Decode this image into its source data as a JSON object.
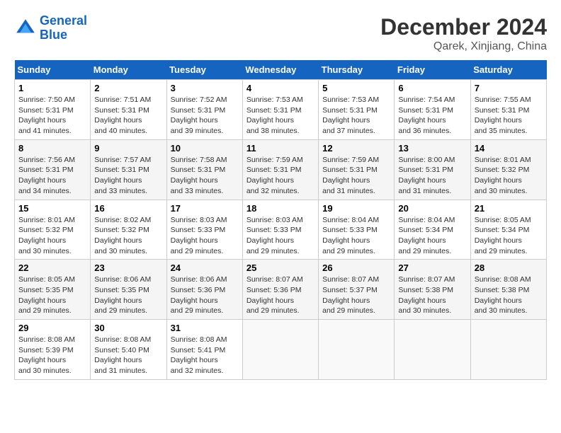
{
  "header": {
    "logo_line1": "General",
    "logo_line2": "Blue",
    "month_title": "December 2024",
    "location": "Qarek, Xinjiang, China"
  },
  "weekdays": [
    "Sunday",
    "Monday",
    "Tuesday",
    "Wednesday",
    "Thursday",
    "Friday",
    "Saturday"
  ],
  "weeks": [
    [
      {
        "day": "1",
        "sunrise": "7:50 AM",
        "sunset": "5:31 PM",
        "daylight": "9 hours and 41 minutes."
      },
      {
        "day": "2",
        "sunrise": "7:51 AM",
        "sunset": "5:31 PM",
        "daylight": "9 hours and 40 minutes."
      },
      {
        "day": "3",
        "sunrise": "7:52 AM",
        "sunset": "5:31 PM",
        "daylight": "9 hours and 39 minutes."
      },
      {
        "day": "4",
        "sunrise": "7:53 AM",
        "sunset": "5:31 PM",
        "daylight": "9 hours and 38 minutes."
      },
      {
        "day": "5",
        "sunrise": "7:53 AM",
        "sunset": "5:31 PM",
        "daylight": "9 hours and 37 minutes."
      },
      {
        "day": "6",
        "sunrise": "7:54 AM",
        "sunset": "5:31 PM",
        "daylight": "9 hours and 36 minutes."
      },
      {
        "day": "7",
        "sunrise": "7:55 AM",
        "sunset": "5:31 PM",
        "daylight": "9 hours and 35 minutes."
      }
    ],
    [
      {
        "day": "8",
        "sunrise": "7:56 AM",
        "sunset": "5:31 PM",
        "daylight": "9 hours and 34 minutes."
      },
      {
        "day": "9",
        "sunrise": "7:57 AM",
        "sunset": "5:31 PM",
        "daylight": "9 hours and 33 minutes."
      },
      {
        "day": "10",
        "sunrise": "7:58 AM",
        "sunset": "5:31 PM",
        "daylight": "9 hours and 33 minutes."
      },
      {
        "day": "11",
        "sunrise": "7:59 AM",
        "sunset": "5:31 PM",
        "daylight": "9 hours and 32 minutes."
      },
      {
        "day": "12",
        "sunrise": "7:59 AM",
        "sunset": "5:31 PM",
        "daylight": "9 hours and 31 minutes."
      },
      {
        "day": "13",
        "sunrise": "8:00 AM",
        "sunset": "5:31 PM",
        "daylight": "9 hours and 31 minutes."
      },
      {
        "day": "14",
        "sunrise": "8:01 AM",
        "sunset": "5:32 PM",
        "daylight": "9 hours and 30 minutes."
      }
    ],
    [
      {
        "day": "15",
        "sunrise": "8:01 AM",
        "sunset": "5:32 PM",
        "daylight": "9 hours and 30 minutes."
      },
      {
        "day": "16",
        "sunrise": "8:02 AM",
        "sunset": "5:32 PM",
        "daylight": "9 hours and 30 minutes."
      },
      {
        "day": "17",
        "sunrise": "8:03 AM",
        "sunset": "5:33 PM",
        "daylight": "9 hours and 29 minutes."
      },
      {
        "day": "18",
        "sunrise": "8:03 AM",
        "sunset": "5:33 PM",
        "daylight": "9 hours and 29 minutes."
      },
      {
        "day": "19",
        "sunrise": "8:04 AM",
        "sunset": "5:33 PM",
        "daylight": "9 hours and 29 minutes."
      },
      {
        "day": "20",
        "sunrise": "8:04 AM",
        "sunset": "5:34 PM",
        "daylight": "9 hours and 29 minutes."
      },
      {
        "day": "21",
        "sunrise": "8:05 AM",
        "sunset": "5:34 PM",
        "daylight": "9 hours and 29 minutes."
      }
    ],
    [
      {
        "day": "22",
        "sunrise": "8:05 AM",
        "sunset": "5:35 PM",
        "daylight": "9 hours and 29 minutes."
      },
      {
        "day": "23",
        "sunrise": "8:06 AM",
        "sunset": "5:35 PM",
        "daylight": "9 hours and 29 minutes."
      },
      {
        "day": "24",
        "sunrise": "8:06 AM",
        "sunset": "5:36 PM",
        "daylight": "9 hours and 29 minutes."
      },
      {
        "day": "25",
        "sunrise": "8:07 AM",
        "sunset": "5:36 PM",
        "daylight": "9 hours and 29 minutes."
      },
      {
        "day": "26",
        "sunrise": "8:07 AM",
        "sunset": "5:37 PM",
        "daylight": "9 hours and 29 minutes."
      },
      {
        "day": "27",
        "sunrise": "8:07 AM",
        "sunset": "5:38 PM",
        "daylight": "9 hours and 30 minutes."
      },
      {
        "day": "28",
        "sunrise": "8:08 AM",
        "sunset": "5:38 PM",
        "daylight": "9 hours and 30 minutes."
      }
    ],
    [
      {
        "day": "29",
        "sunrise": "8:08 AM",
        "sunset": "5:39 PM",
        "daylight": "9 hours and 30 minutes."
      },
      {
        "day": "30",
        "sunrise": "8:08 AM",
        "sunset": "5:40 PM",
        "daylight": "9 hours and 31 minutes."
      },
      {
        "day": "31",
        "sunrise": "8:08 AM",
        "sunset": "5:41 PM",
        "daylight": "9 hours and 32 minutes."
      },
      null,
      null,
      null,
      null
    ]
  ]
}
